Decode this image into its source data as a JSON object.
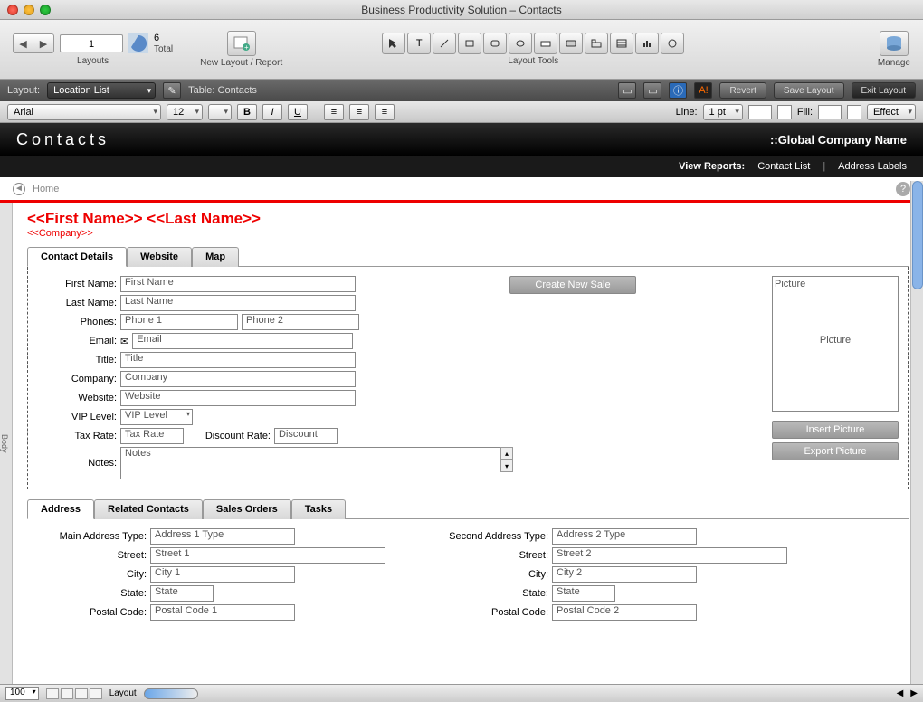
{
  "window": {
    "title": "Business Productivity Solution – Contacts"
  },
  "toolbar": {
    "record_current": "1",
    "record_total": "6",
    "record_total_label": "Total",
    "layouts_label": "Layouts",
    "new_layout_label": "New Layout / Report",
    "layout_tools_label": "Layout Tools",
    "manage_label": "Manage"
  },
  "darkbar": {
    "layout_label": "Layout:",
    "layout_value": "Location List",
    "table_label": "Table: Contacts",
    "revert": "Revert",
    "save_layout": "Save Layout",
    "exit_layout": "Exit Layout",
    "badge": "A!"
  },
  "formatbar": {
    "font": "Arial",
    "size": "12",
    "line_label": "Line:",
    "line_value": "1 pt",
    "fill_label": "Fill:",
    "effect_label": "Effect"
  },
  "header": {
    "title": "Contacts",
    "company_label": "::Global Company Name",
    "view_reports": "View Reports:",
    "contact_list": "Contact List",
    "address_labels": "Address Labels"
  },
  "crumb": {
    "home": "Home"
  },
  "merge": {
    "name": "<<First Name>> <<Last Name>>",
    "company": "<<Company>>"
  },
  "tabs": {
    "contact_details": "Contact Details",
    "website": "Website",
    "map": "Map"
  },
  "fields": {
    "first_name": {
      "label": "First Name:",
      "value": "First Name"
    },
    "last_name": {
      "label": "Last Name:",
      "value": "Last Name"
    },
    "phones": {
      "label": "Phones:",
      "value1": "Phone 1",
      "value2": "Phone 2"
    },
    "email": {
      "label": "Email:",
      "value": "Email"
    },
    "title": {
      "label": "Title:",
      "value": "Title"
    },
    "company": {
      "label": "Company:",
      "value": "Company"
    },
    "website": {
      "label": "Website:",
      "value": "Website"
    },
    "vip": {
      "label": "VIP Level:",
      "value": "VIP Level"
    },
    "tax": {
      "label": "Tax Rate:",
      "value": "Tax Rate"
    },
    "discount": {
      "label": "Discount Rate:",
      "value": "Discount"
    },
    "notes": {
      "label": "Notes:",
      "value": "Notes"
    }
  },
  "actions": {
    "create_sale": "Create New Sale",
    "insert_picture": "Insert Picture",
    "export_picture": "Export Picture"
  },
  "picture": {
    "top": "Picture",
    "mid": "Picture"
  },
  "subtabs": {
    "address": "Address",
    "related": "Related Contacts",
    "sales": "Sales Orders",
    "tasks": "Tasks"
  },
  "addr1": {
    "type": {
      "label": "Main Address Type:",
      "value": "Address 1 Type"
    },
    "street": {
      "label": "Street:",
      "value": "Street 1"
    },
    "city": {
      "label": "City:",
      "value": "City 1"
    },
    "state": {
      "label": "State:",
      "value": "State"
    },
    "postal": {
      "label": "Postal Code:",
      "value": "Postal Code 1"
    }
  },
  "addr2": {
    "type": {
      "label": "Second Address Type:",
      "value": "Address 2 Type"
    },
    "street": {
      "label": "Street:",
      "value": "Street 2"
    },
    "city": {
      "label": "City:",
      "value": "City 2"
    },
    "state": {
      "label": "State:",
      "value": "State"
    },
    "postal": {
      "label": "Postal Code:",
      "value": "Postal Code 2"
    }
  },
  "statusbar": {
    "zoom": "100",
    "mode": "Layout"
  },
  "ruler": {
    "section": "Body"
  }
}
